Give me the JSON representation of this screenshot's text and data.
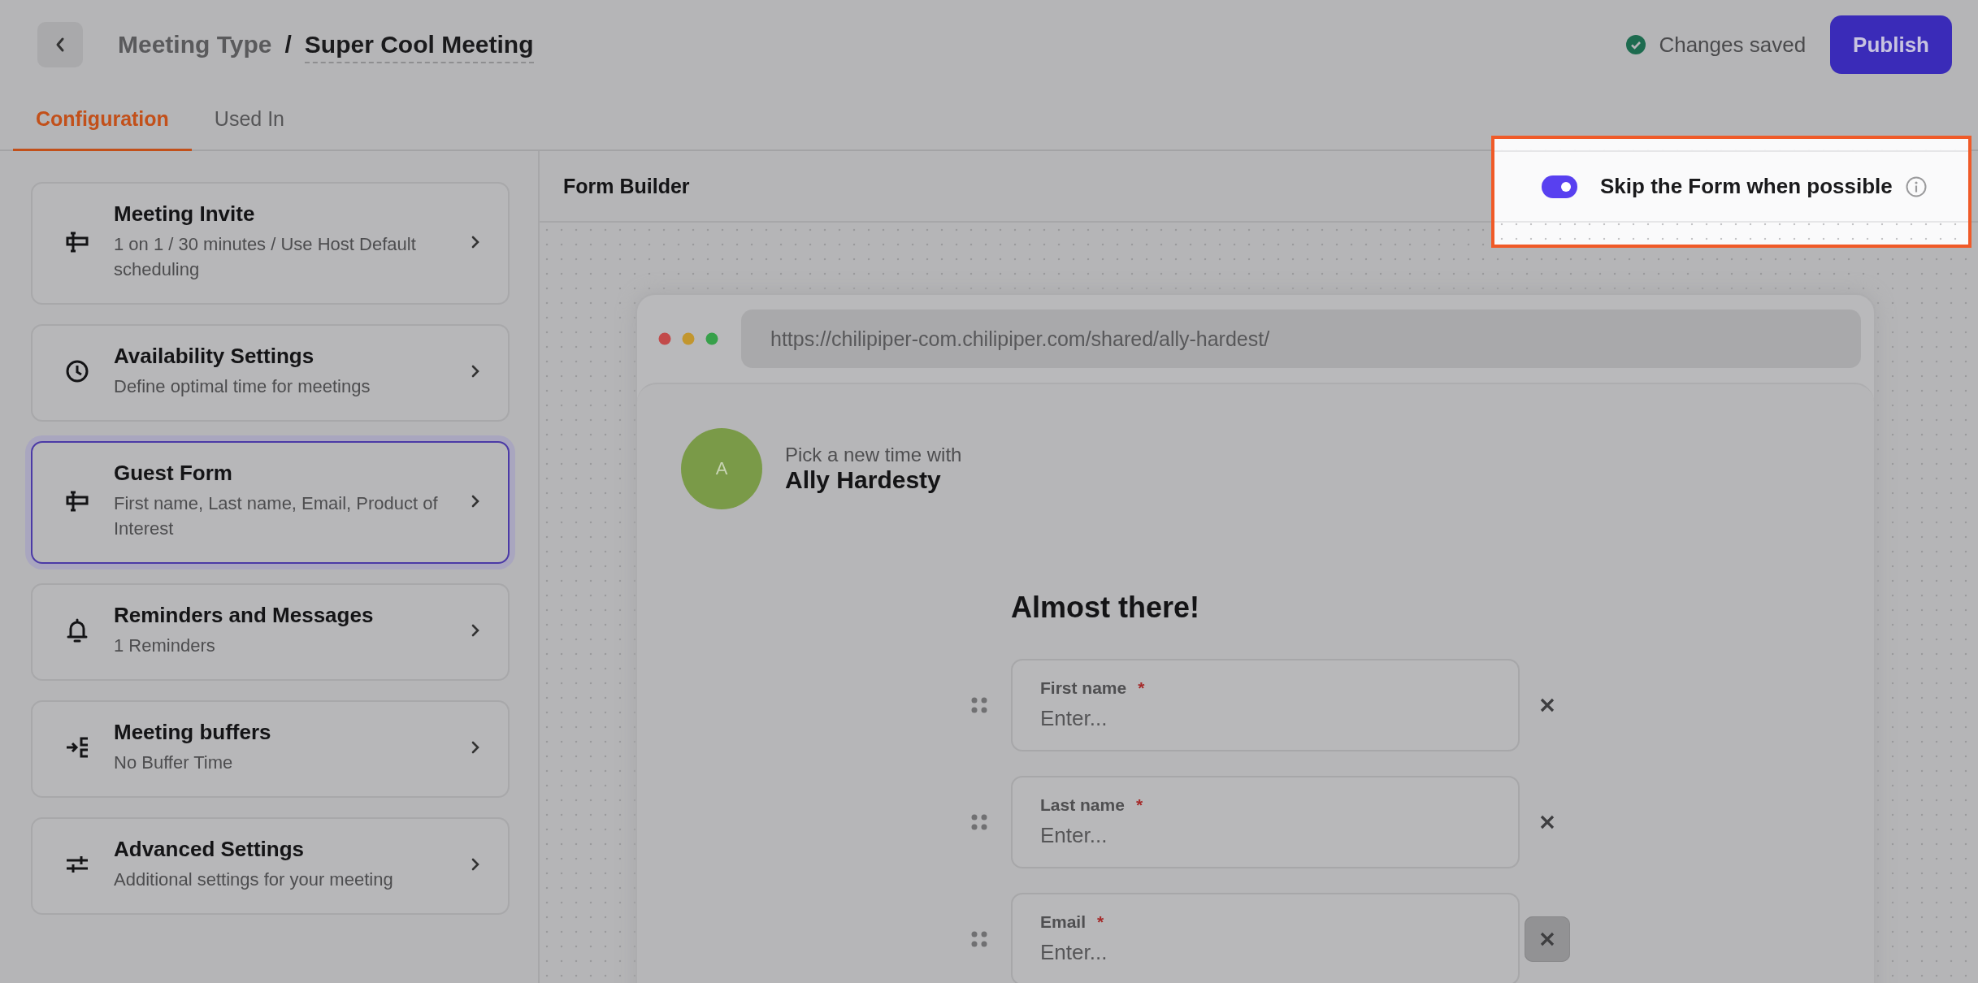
{
  "header": {
    "breadcrumb_parent": "Meeting Type",
    "separator": "/",
    "title": "Super Cool Meeting",
    "save_status": "Changes saved",
    "publish_button": "Publish"
  },
  "tabs": [
    {
      "label": "Configuration",
      "selected": true
    },
    {
      "label": "Used In",
      "selected": false
    }
  ],
  "sidebar": {
    "items": [
      {
        "kind": "form",
        "title": "Meeting Invite",
        "subtitle": "1 on 1 / 30 minutes / Use Host Default scheduling",
        "selected": false
      },
      {
        "kind": "clock",
        "title": "Availability Settings",
        "subtitle": "Define optimal time for meetings",
        "selected": false
      },
      {
        "kind": "form",
        "title": "Guest Form",
        "subtitle": "First name, Last name, Email, Product of Interest",
        "selected": true
      },
      {
        "kind": "bell",
        "title": "Reminders and Messages",
        "subtitle": "1 Reminders",
        "selected": false
      },
      {
        "kind": "buffer",
        "title": "Meeting buffers",
        "subtitle": "No Buffer Time",
        "selected": false
      },
      {
        "kind": "sliders",
        "title": "Advanced Settings",
        "subtitle": "Additional settings for your meeting",
        "selected": false
      }
    ]
  },
  "form_builder": {
    "title": "Form Builder",
    "skip_toggle": {
      "label": "Skip the Form when possible",
      "on": true
    },
    "preview": {
      "url": "https://chilipiper-com.chilipiper.com/shared/ally-hardest/",
      "avatar_initial": "A",
      "intro": "Pick a new time with",
      "host_name": "Ally Hardesty",
      "heading": "Almost there!",
      "fields": [
        {
          "label": "First name",
          "required_mark": "*",
          "placeholder": "Enter...",
          "hovered": false
        },
        {
          "label": "Last name",
          "required_mark": "*",
          "placeholder": "Enter...",
          "hovered": false
        },
        {
          "label": "Email",
          "required_mark": "*",
          "placeholder": "Enter...",
          "hovered": true
        }
      ]
    }
  }
}
